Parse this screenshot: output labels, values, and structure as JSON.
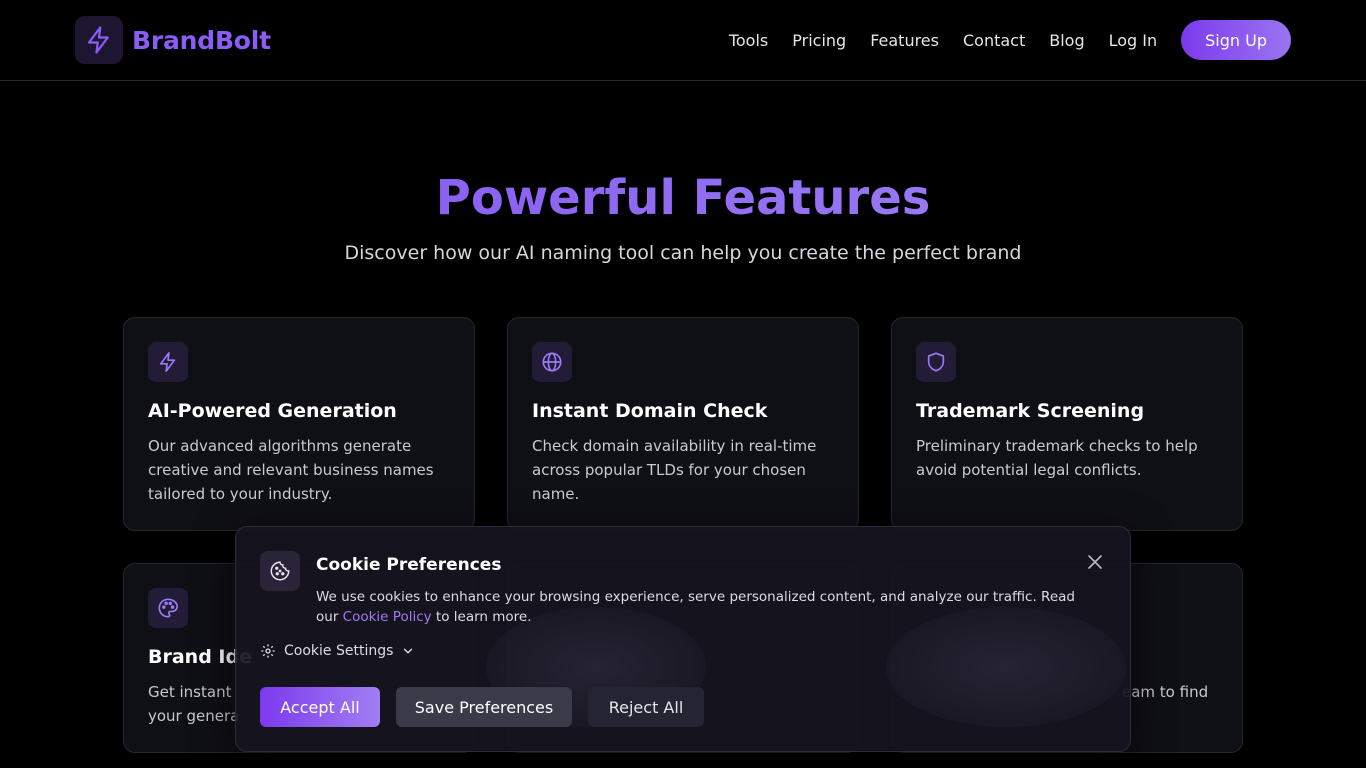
{
  "header": {
    "brand": "BrandBolt",
    "nav": [
      "Tools",
      "Pricing",
      "Features",
      "Contact",
      "Blog",
      "Log In"
    ],
    "signup": "Sign Up"
  },
  "hero": {
    "title": "Powerful Features",
    "subtitle": "Discover how our AI naming tool can help you create the perfect brand"
  },
  "features": [
    {
      "icon": "bolt-icon",
      "title": "AI-Powered Generation",
      "desc": "Our advanced algorithms generate creative and relevant business names tailored to your industry."
    },
    {
      "icon": "globe-icon",
      "title": "Instant Domain Check",
      "desc": "Check domain availability in real-time across popular TLDs for your chosen name."
    },
    {
      "icon": "shield-icon",
      "title": "Trademark Screening",
      "desc": "Preliminary trademark checks to help avoid potential legal conflicts."
    },
    {
      "icon": "palette-icon",
      "title": "Brand Ide",
      "desc": "Get instant your genera"
    },
    {
      "icon": "",
      "title": "",
      "desc": ""
    },
    {
      "icon": "",
      "title": "",
      "desc": "eam to find"
    }
  ],
  "cookie": {
    "title": "Cookie Preferences",
    "text_before": "We use cookies to enhance your browsing experience, serve personalized content, and analyze our traffic. Read our",
    "link": "Cookie Policy",
    "text_after": "to learn more.",
    "settings": "Cookie Settings",
    "accept": "Accept All",
    "save": "Save Preferences",
    "reject": "Reject All"
  },
  "colors": {
    "accent": "#8b5cf6",
    "background": "#000000",
    "card": "#0f0f16"
  }
}
